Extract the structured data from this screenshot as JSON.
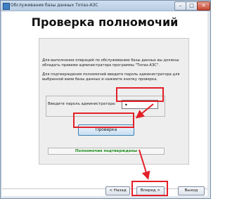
{
  "window": {
    "title": "Обслуживание базы данных Топаз-АЗС",
    "controls": {
      "minimize": "–",
      "maximize": "□",
      "close": "✕"
    }
  },
  "page": {
    "heading": "Проверка полномочий",
    "paragraph1": "Для выполнения операций по обслуживанию базы данных вы должны обладать правами администратора программы \"Топаз-АЗС\".",
    "paragraph2": "Для подтверждения полномочий введите пароль администратора для выбранной вами базы данных и нажмите кнопку проверка.",
    "password_label": "Введите пароль администратора:",
    "password_value": "•",
    "check_button": "Проверка",
    "status": "Полномочия подтверждены"
  },
  "nav": {
    "back": "< Назад",
    "next": "Вперед >",
    "exit": "Выход"
  },
  "colors": {
    "highlight": "#e31f28",
    "status_green": "#1a8a1a"
  }
}
